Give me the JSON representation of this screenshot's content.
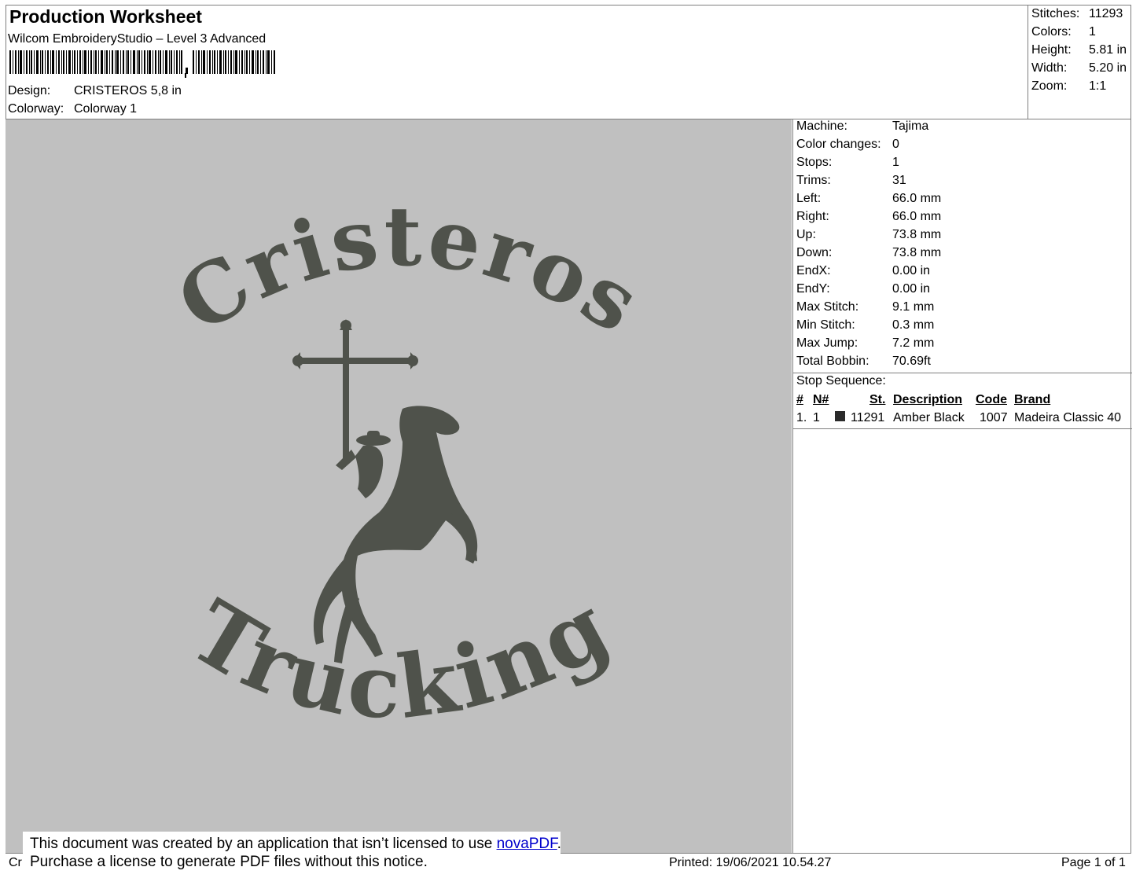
{
  "header": {
    "title": "Production Worksheet",
    "software": "Wilcom EmbroideryStudio – Level 3 Advanced",
    "design_label": "Design:",
    "design_value": "CRISTEROS 5,8 in",
    "colorway_label": "Colorway:",
    "colorway_value": "Colorway 1"
  },
  "stats": [
    {
      "label": "Stitches:",
      "value": "11293"
    },
    {
      "label": "Colors:",
      "value": "1"
    },
    {
      "label": "Height:",
      "value": "5.81 in"
    },
    {
      "label": "Width:",
      "value": "5.20 in"
    },
    {
      "label": "Zoom:",
      "value": "1:1"
    }
  ],
  "design": {
    "top_text": "Cristeros",
    "bottom_text": "Trucking",
    "thread_color": "#4f524b",
    "background_color": "#c0c0c0"
  },
  "machine_info": [
    {
      "label": "Machine:",
      "value": "Tajima"
    },
    {
      "label": "Color changes:",
      "value": "0"
    },
    {
      "label": "Stops:",
      "value": "1"
    },
    {
      "label": "Trims:",
      "value": "31"
    },
    {
      "label": "Left:",
      "value": "66.0 mm"
    },
    {
      "label": "Right:",
      "value": "66.0 mm"
    },
    {
      "label": "Up:",
      "value": "73.8 mm"
    },
    {
      "label": "Down:",
      "value": "73.8 mm"
    },
    {
      "label": "EndX:",
      "value": "0.00 in"
    },
    {
      "label": "EndY:",
      "value": "0.00 in"
    },
    {
      "label": "Max Stitch:",
      "value": "9.1 mm"
    },
    {
      "label": "Min Stitch:",
      "value": "0.3 mm"
    },
    {
      "label": "Max Jump:",
      "value": "7.2 mm"
    },
    {
      "label": "Total Bobbin:",
      "value": "70.69ft"
    }
  ],
  "stop_sequence": {
    "title": "Stop Sequence:",
    "headers": {
      "num": "#",
      "n": "N#",
      "st": "St.",
      "description": "Description",
      "code": "Code",
      "brand": "Brand"
    },
    "rows": [
      {
        "num": "1.",
        "n": "1",
        "swatch": "#2b2b2b",
        "st": "11291",
        "description": "Amber Black",
        "code": "1007",
        "brand": "Madeira Classic 40"
      }
    ]
  },
  "footer": {
    "left_fragment": "Cr",
    "printed": "Printed: 19/06/2021 10.54.27",
    "page": "Page 1 of 1"
  },
  "notice": {
    "line1_before": "This document was created by an application that isn’t licensed to use ",
    "link": "novaPDF",
    "line1_after": ".",
    "line2": "Purchase a license to generate PDF files without this notice."
  }
}
